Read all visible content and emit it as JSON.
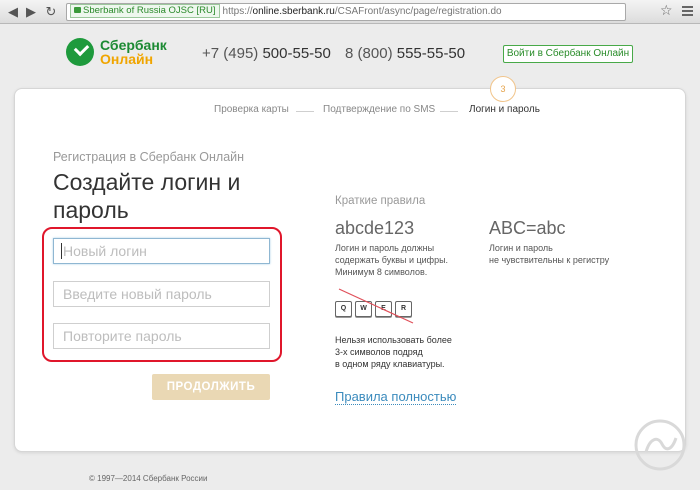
{
  "browser": {
    "ev_badge": "Sberbank of Russia OJSC [RU]",
    "url_scheme": "https://",
    "url_host": "online.sberbank.ru",
    "url_path": "/CSAFront/async/page/registration.do"
  },
  "header": {
    "logo_line1": "Сбербанк",
    "logo_line2": "Онлайн",
    "phone1_prefix": "+7 (495) ",
    "phone1_number": "500-55-50",
    "phone2_prefix": "8 (800) ",
    "phone2_number": "555-55-50",
    "login_button": "Войти в Сбербанк Онлайн"
  },
  "steps": {
    "items": [
      "Проверка карты",
      "Подтверждение по SMS",
      "Логин и пароль"
    ],
    "current_number": "3"
  },
  "form": {
    "subtitle": "Регистрация в Сбербанк Онлайн",
    "title": "Создайте логин и пароль",
    "login_placeholder": "Новый логин",
    "password_placeholder": "Введите новый пароль",
    "repeat_placeholder": "Повторите пароль",
    "continue_button": "ПРОДОЛЖИТЬ"
  },
  "rules": {
    "heading": "Краткие правила",
    "rule1_example": "abcde123",
    "rule1_text_line1": "Логин и пароль должны",
    "rule1_text_line2": "содержать буквы и цифры.",
    "rule1_text_line3": "Минимум 8 символов.",
    "rule2_example": "ABC=abc",
    "rule2_text_line1": "Логин и пароль",
    "rule2_text_line2": "не чувствительны к регистру",
    "keys": [
      "Q",
      "W",
      "E",
      "R"
    ],
    "keys_text_line1": "Нельзя использовать более",
    "keys_text_line2": "3-х символов подряд",
    "keys_text_line3": "в одном ряду клавиатуры.",
    "full_rules_link": "Правила полностью"
  },
  "footer": {
    "copyright": "© 1997—2014 Сбербанк России"
  },
  "colors": {
    "brand_green": "#1e9a3c",
    "brand_orange": "#f0a500",
    "highlight_red": "#e0162b",
    "link_blue": "#3b8bbd"
  }
}
